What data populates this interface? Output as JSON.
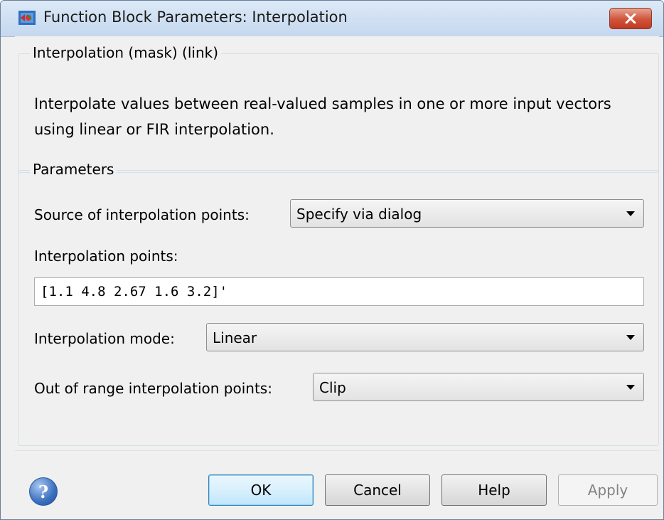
{
  "window": {
    "title": "Function Block Parameters: Interpolation",
    "icons": {
      "app": "simulink-block-icon",
      "close": "close-icon"
    }
  },
  "description_group": {
    "legend": "Interpolation (mask) (link)",
    "text": "Interpolate values between real-valued samples in one or more input vectors using linear or FIR interpolation."
  },
  "parameters": {
    "legend": "Parameters",
    "source": {
      "label": "Source of interpolation points:",
      "value": "Specify via dialog"
    },
    "points": {
      "label": "Interpolation points:",
      "value": "[1.1 4.8 2.67 1.6 3.2]'"
    },
    "mode": {
      "label": "Interpolation mode:",
      "value": "Linear"
    },
    "out_of_range": {
      "label": "Out of range interpolation points:",
      "value": "Clip"
    }
  },
  "footer": {
    "help_icon": "help-question-icon",
    "ok": "OK",
    "cancel": "Cancel",
    "help": "Help",
    "apply": "Apply"
  },
  "colors": {
    "title_bar": "#c5d8ee",
    "close_button": "#d0533a",
    "dialog_bg": "#f0f0f0",
    "default_button": "#d9f0fc"
  }
}
